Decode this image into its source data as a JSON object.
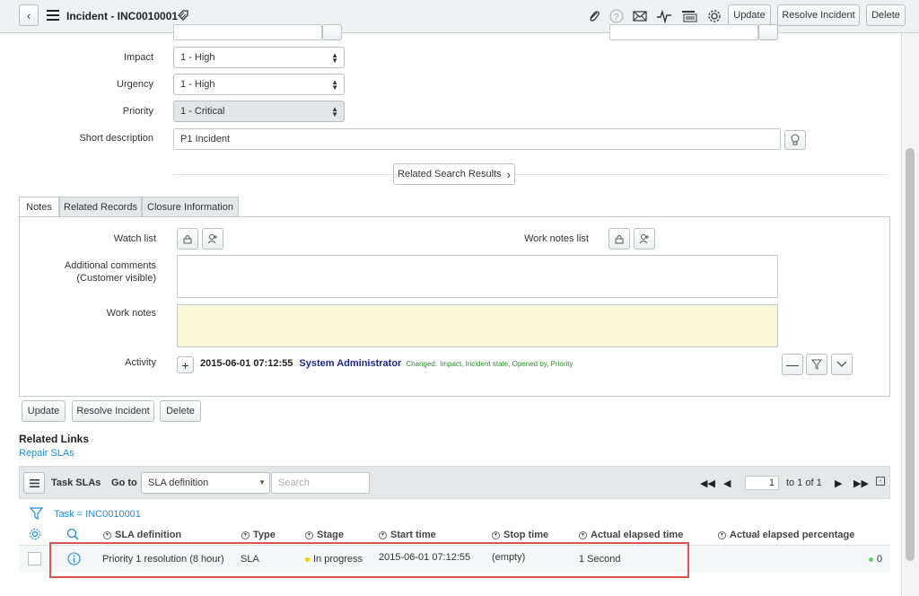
{
  "header": {
    "title": "Incident - INC0010001",
    "update_label": "Update",
    "resolve_label": "Resolve Incident",
    "delete_label": "Delete"
  },
  "form": {
    "impact": {
      "label": "Impact",
      "value": "1 - High"
    },
    "urgency": {
      "label": "Urgency",
      "value": "1 - High"
    },
    "priority": {
      "label": "Priority",
      "value": "1 - Critical"
    },
    "short_description": {
      "label": "Short description",
      "value": "P1 Incident"
    },
    "related_search_label": "Related Search Results"
  },
  "tabs": [
    {
      "label": "Notes"
    },
    {
      "label": "Related Records"
    },
    {
      "label": "Closure Information"
    }
  ],
  "notes": {
    "watch_list_label": "Watch list",
    "work_notes_list_label": "Work notes list",
    "additional_comments_label_1": "Additional comments",
    "additional_comments_label_2": "(Customer visible)",
    "work_notes_label": "Work notes",
    "activity_label": "Activity",
    "activity": {
      "timestamp": "2015-06-01 07:12:55",
      "user": "System Administrator",
      "changed": "Changed:",
      "fields": "Impact, Incident state, Opened by, Priority"
    }
  },
  "bottom_buttons": {
    "update_label": "Update",
    "resolve_label": "Resolve Incident",
    "delete_label": "Delete"
  },
  "related_links": {
    "title": "Related Links",
    "repair_slas": "Repair SLAs"
  },
  "task_slas": {
    "title": "Task SLAs",
    "goto_label": "Go to",
    "goto_field": "SLA definition",
    "search_placeholder": "Search",
    "page_value": "1",
    "page_range": "to 1 of 1",
    "filter_text": "Task = INC0010001",
    "columns": [
      "SLA definition",
      "Type",
      "Stage",
      "Start time",
      "Stop time",
      "Actual elapsed time",
      "Actual elapsed percentage"
    ],
    "row": {
      "sla_definition": "Priority 1 resolution (8 hour)",
      "type": "SLA",
      "stage": "In progress",
      "start_time": "2015-06-01 07:12:55",
      "stop_time": "(empty)",
      "actual_elapsed_time": "1 Second",
      "actual_elapsed_percentage": "0"
    }
  },
  "colors": {
    "link": "#1f8dd6",
    "activity_user": "#1c2a8c",
    "activity_changed": "#2d8a2d",
    "highlight_box": "#d9534f",
    "work_notes_bg": "#f8f8d8",
    "stage_dot": "#f0d000",
    "percent_dot": "#6ccf6c"
  }
}
